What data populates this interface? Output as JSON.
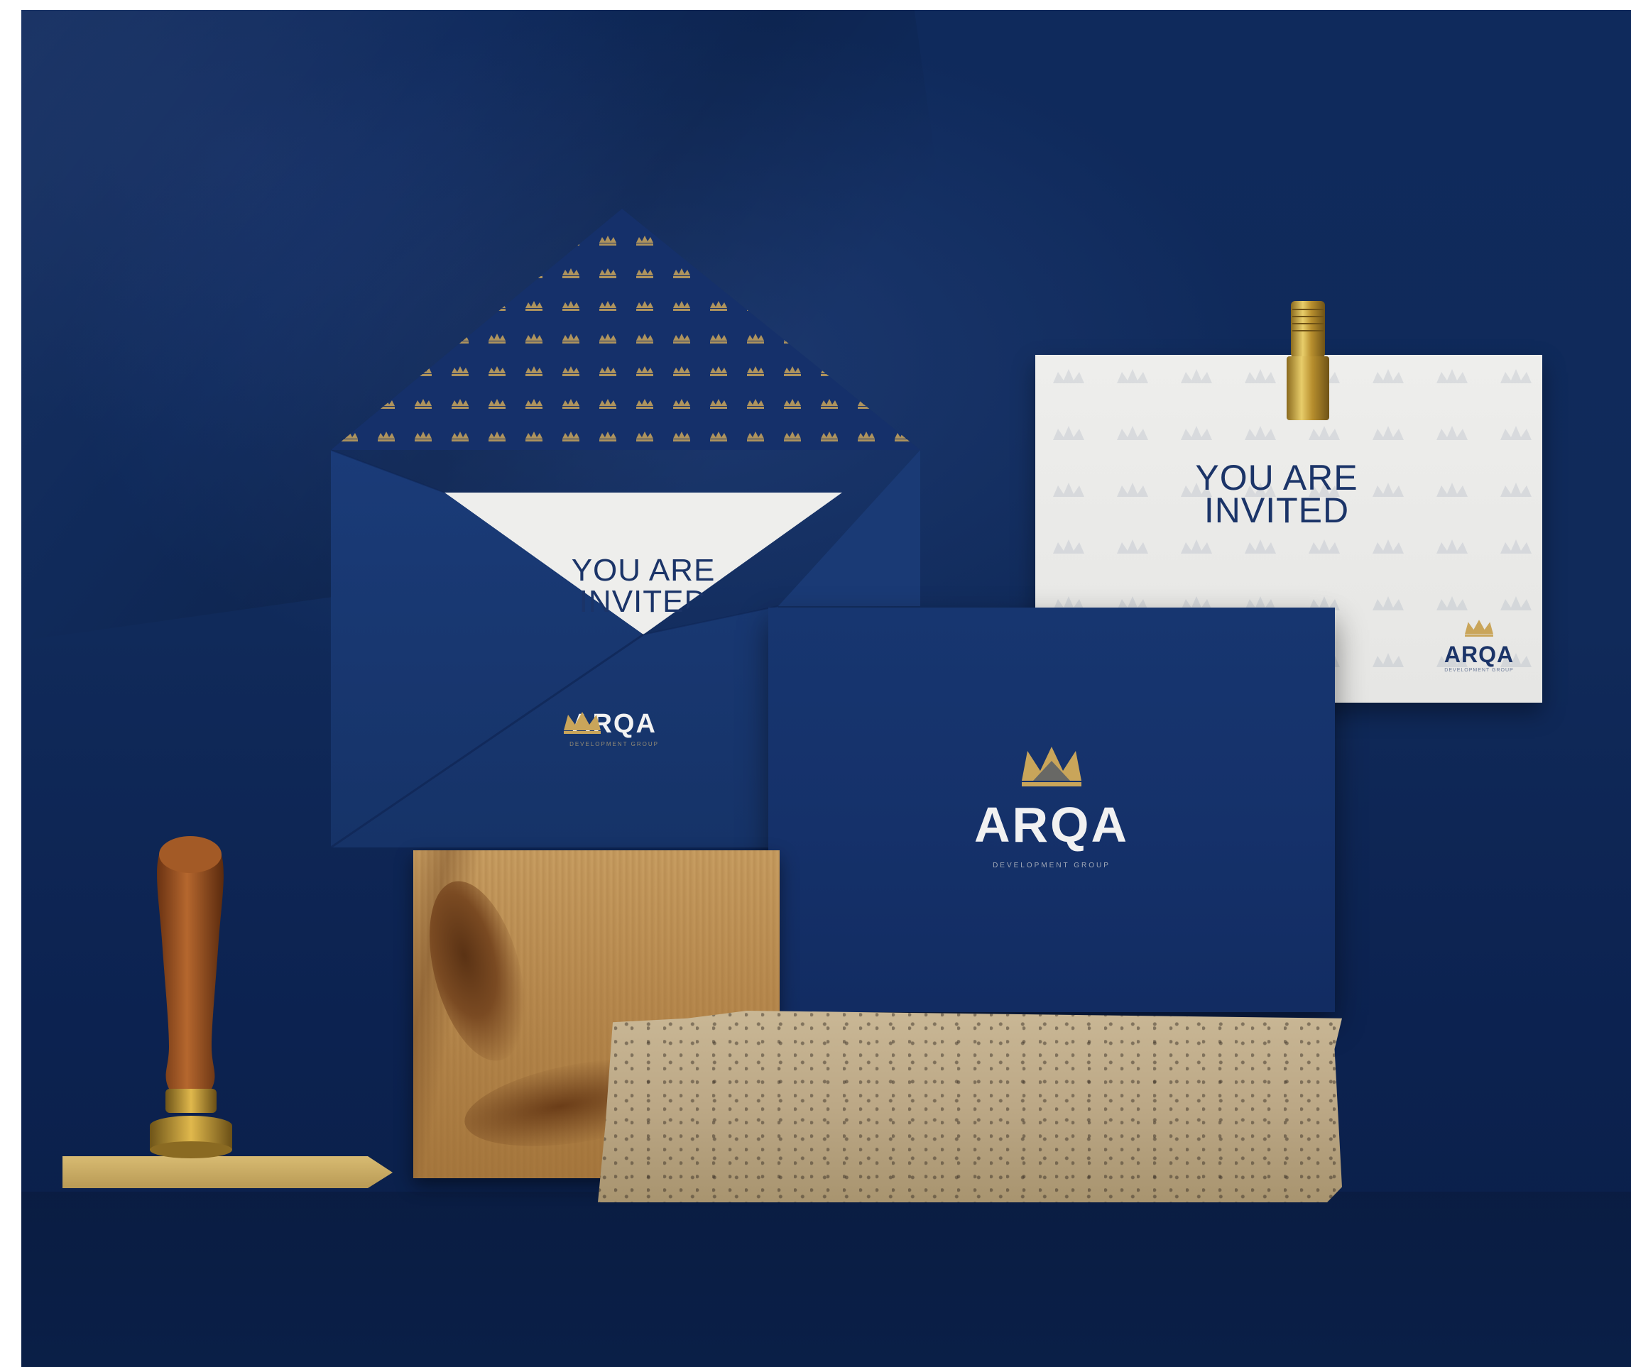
{
  "scene": {
    "description_colors": {
      "background": "#102a5a",
      "gold": "#c9a55a",
      "navy_text": "#1b3468",
      "white_card": "#e9e9e7"
    }
  },
  "envelope": {
    "card_text_line1": "YOU ARE",
    "card_text_line2": "INVITED",
    "logo_icon": "crown-icon",
    "logo_name": "ARQA",
    "logo_tagline": "DEVELOPMENT GROUP"
  },
  "white_card": {
    "title_line1": "YOU ARE",
    "title_line2": "INVITED",
    "logo_icon": "crown-icon",
    "logo_name": "ARQA",
    "logo_tagline": "DEVELOPMENT GROUP"
  },
  "blue_card": {
    "logo_icon": "crown-icon",
    "logo_name": "ARQA",
    "logo_tagline": "DEVELOPMENT GROUP"
  }
}
